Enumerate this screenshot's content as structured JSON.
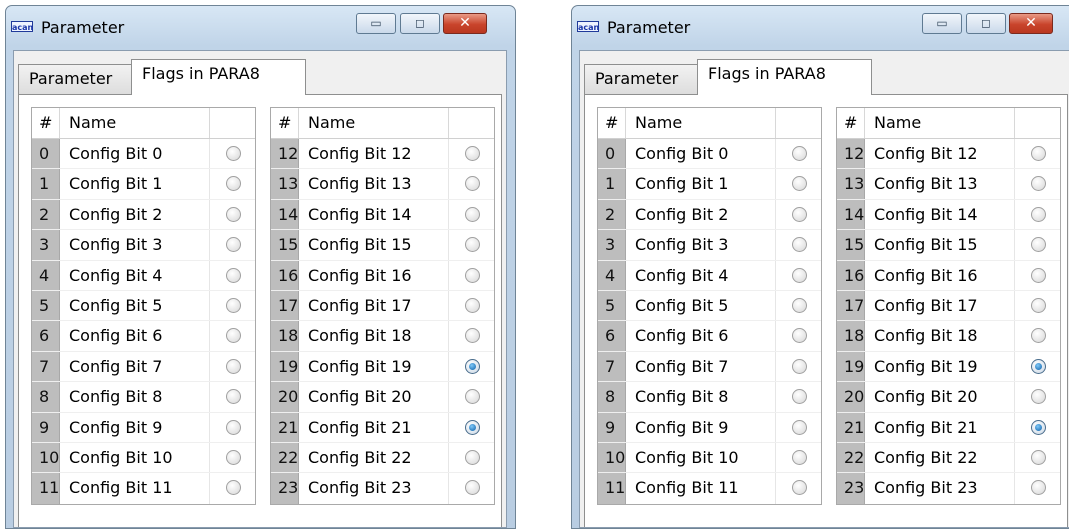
{
  "windows": [
    {
      "app_icon_text": "acan",
      "title": "Parameter",
      "buttons": {
        "minimize": "▭",
        "maximize": "◻",
        "close": "✕"
      },
      "tabs": [
        "Parameter",
        "Flags in PARA8"
      ],
      "active_tab": "Flags in PARA8"
    },
    {
      "app_icon_text": "acan",
      "title": "Parameter",
      "buttons": {
        "minimize": "▭",
        "maximize": "◻",
        "close": "✕"
      },
      "tabs": [
        "Parameter",
        "Flags in PARA8"
      ],
      "active_tab": "Flags in PARA8"
    }
  ],
  "table": {
    "columns": [
      "#",
      "Name",
      ""
    ],
    "left_rows": [
      {
        "num": "0",
        "name": "Config Bit 0",
        "checked": false
      },
      {
        "num": "1",
        "name": "Config Bit 1",
        "checked": false
      },
      {
        "num": "2",
        "name": "Config Bit 2",
        "checked": false
      },
      {
        "num": "3",
        "name": "Config Bit 3",
        "checked": false
      },
      {
        "num": "4",
        "name": "Config Bit 4",
        "checked": false
      },
      {
        "num": "5",
        "name": "Config Bit 5",
        "checked": false
      },
      {
        "num": "6",
        "name": "Config Bit 6",
        "checked": false
      },
      {
        "num": "7",
        "name": "Config Bit 7",
        "checked": false
      },
      {
        "num": "8",
        "name": "Config Bit 8",
        "checked": false
      },
      {
        "num": "9",
        "name": "Config Bit 9",
        "checked": false
      },
      {
        "num": "10",
        "name": "Config Bit 10",
        "checked": false
      },
      {
        "num": "11",
        "name": "Config Bit 11",
        "checked": false
      }
    ],
    "right_rows": [
      {
        "num": "12",
        "name": "Config Bit 12",
        "checked": false
      },
      {
        "num": "13",
        "name": "Config Bit 13",
        "checked": false
      },
      {
        "num": "14",
        "name": "Config Bit 14",
        "checked": false
      },
      {
        "num": "15",
        "name": "Config Bit 15",
        "checked": false
      },
      {
        "num": "16",
        "name": "Config Bit 16",
        "checked": false
      },
      {
        "num": "17",
        "name": "Config Bit 17",
        "checked": false
      },
      {
        "num": "18",
        "name": "Config Bit 18",
        "checked": false
      },
      {
        "num": "19",
        "name": "Config Bit 19",
        "checked": true
      },
      {
        "num": "20",
        "name": "Config Bit 20",
        "checked": false
      },
      {
        "num": "21",
        "name": "Config Bit 21",
        "checked": true
      },
      {
        "num": "22",
        "name": "Config Bit 22",
        "checked": false
      },
      {
        "num": "23",
        "name": "Config Bit 23",
        "checked": false
      }
    ]
  },
  "colors": {
    "row_number_bg": "#bdbdbd",
    "radio_selected": "#0b5fa8",
    "close_button": "#c9442c"
  }
}
